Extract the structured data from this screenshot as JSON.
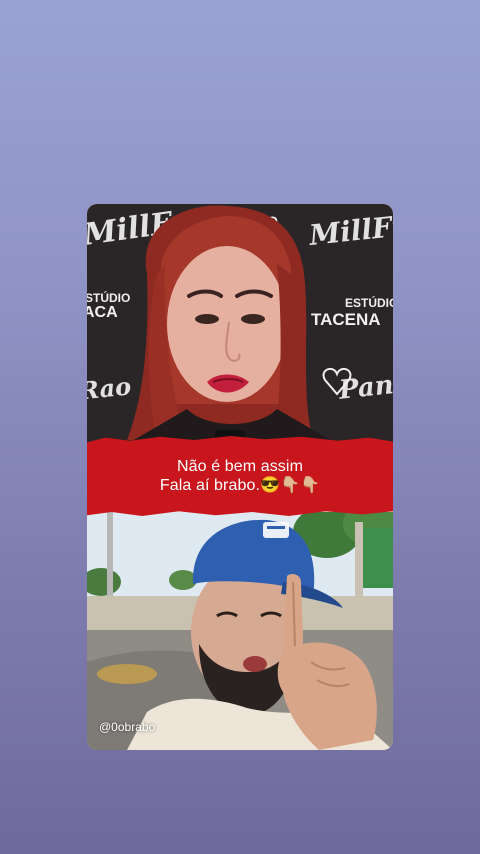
{
  "video": {
    "top_clip": {
      "backdrop_script_top_left": "MillFran",
      "backdrop_text_top_center": "KO",
      "backdrop_script_top_right": "MillFran",
      "backdrop_studio_left_1": "STÚDIO",
      "backdrop_studio_left_2": "ACA",
      "backdrop_studio_right_1": "ESTÚDIO",
      "backdrop_studio_right_2": "TACENA",
      "backdrop_script_right_lower": "Pano",
      "backdrop_script_left_lower": "Rao"
    },
    "caption": {
      "line1": "Não é bem assim",
      "line2": "Fala aí brabo.😎👇🏼👇🏼"
    },
    "bottom_clip": {
      "watermark": "@0obrabo"
    }
  },
  "colors": {
    "caption_bg": "#c8161c",
    "page_gradient_top": "#9aa2d6",
    "page_gradient_bottom": "#6f6a9c",
    "cap_blue": "#2e5fb0"
  }
}
